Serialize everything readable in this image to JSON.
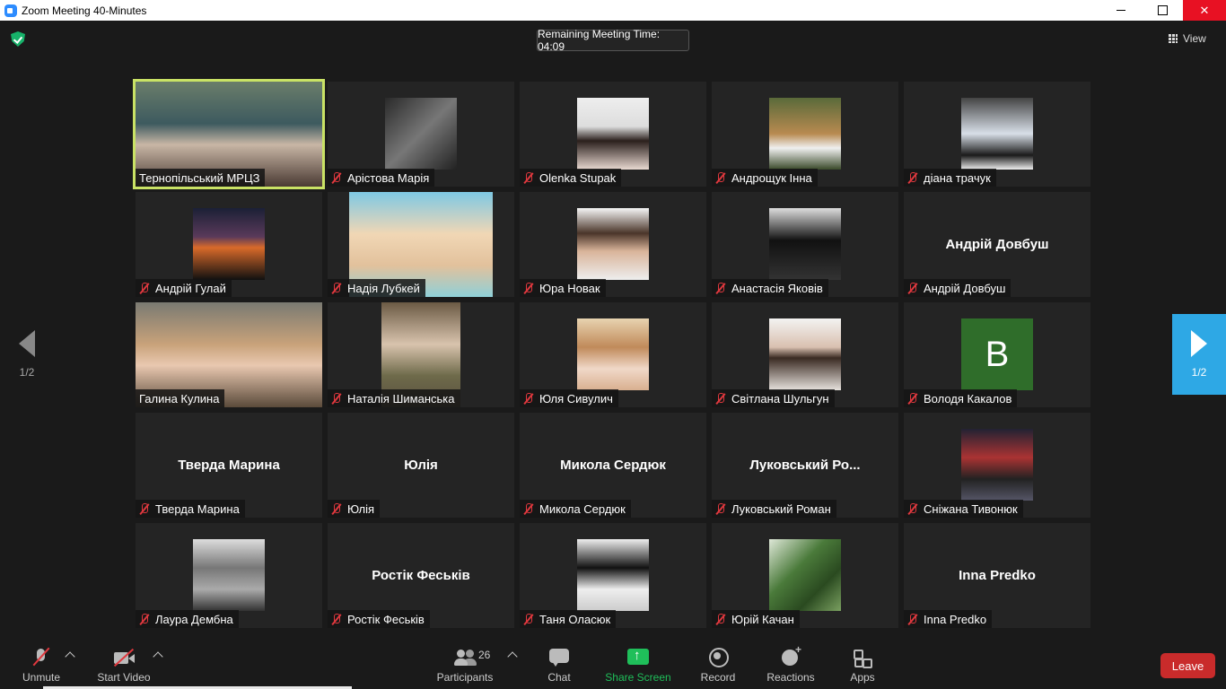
{
  "window": {
    "title": "Zoom Meeting 40-Minutes",
    "minimize_icon": "minimize-icon",
    "maximize_icon": "restore-icon",
    "close_icon": "close-icon",
    "close_label": "✕"
  },
  "topbar": {
    "security_icon": "shield-check-icon",
    "remaining_time": "Remaining Meeting Time: 04:09",
    "view_label": "View"
  },
  "pagination": {
    "prev_label": "1/2",
    "next_label": "1/2",
    "next_color": "#2ea8e5"
  },
  "participants": [
    {
      "name": "Тернопільський МРЦЗ",
      "muted": false,
      "display": "video",
      "active_speaker": true
    },
    {
      "name": "Арістова Марія",
      "muted": true,
      "display": "photo"
    },
    {
      "name": "Olenka Stupak",
      "muted": true,
      "display": "photo"
    },
    {
      "name": "Андрощук Інна",
      "muted": true,
      "display": "photo"
    },
    {
      "name": "діана трачук",
      "muted": true,
      "display": "photo"
    },
    {
      "name": "Андрій Гулай",
      "muted": true,
      "display": "photo"
    },
    {
      "name": "Надія Лубкей",
      "muted": true,
      "display": "video"
    },
    {
      "name": "Юра Новак",
      "muted": true,
      "display": "photo"
    },
    {
      "name": "Анастасія Яковів",
      "muted": true,
      "display": "photo"
    },
    {
      "name": "Андрій Довбуш",
      "muted": true,
      "display": "name",
      "center_name": "Андрій Довбуш"
    },
    {
      "name": "Галина Кулина",
      "muted": false,
      "display": "video"
    },
    {
      "name": "Наталія Шиманська",
      "muted": true,
      "display": "video"
    },
    {
      "name": "Юля Сивулич",
      "muted": true,
      "display": "photo"
    },
    {
      "name": "Світлана Шульгун",
      "muted": true,
      "display": "photo"
    },
    {
      "name": "Володя Какалов",
      "muted": true,
      "display": "letter",
      "letter": "B",
      "avatar_color": "#2f6d2a"
    },
    {
      "name": "Тверда Марина",
      "muted": true,
      "display": "name",
      "center_name": "Тверда Марина"
    },
    {
      "name": "Юлія",
      "muted": true,
      "display": "name",
      "center_name": "Юлія"
    },
    {
      "name": "Микола Сердюк",
      "muted": true,
      "display": "name",
      "center_name": "Микола Сердюк"
    },
    {
      "name": "Луковський Роман",
      "muted": true,
      "display": "name",
      "center_name": "Луковський  Ро..."
    },
    {
      "name": "Сніжана Тивонюк",
      "muted": true,
      "display": "photo"
    },
    {
      "name": "Лаура Дембна",
      "muted": true,
      "display": "photo"
    },
    {
      "name": "Ростік Феськів",
      "muted": true,
      "display": "name",
      "center_name": "Ростік Феськів"
    },
    {
      "name": "Таня Оласюк",
      "muted": true,
      "display": "photo"
    },
    {
      "name": "Юрій Качан",
      "muted": true,
      "display": "photo"
    },
    {
      "name": "Inna Predko",
      "muted": true,
      "display": "name",
      "center_name": "Inna Predko"
    }
  ],
  "toolbar": {
    "unmute_label": "Unmute",
    "start_video_label": "Start Video",
    "participants_label": "Participants",
    "participants_count": "26",
    "chat_label": "Chat",
    "share_screen_label": "Share Screen",
    "record_label": "Record",
    "reactions_label": "Reactions",
    "apps_label": "Apps",
    "leave_label": "Leave",
    "share_color": "#1fbf5a",
    "leave_color": "#c92b2b"
  }
}
